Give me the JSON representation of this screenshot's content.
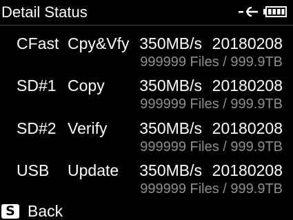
{
  "header": {
    "title": "Detail Status",
    "icons": [
      "connection-icon",
      "battery-icon"
    ]
  },
  "rows": [
    {
      "device": "CFast",
      "operation": "Cpy&Vfy",
      "speed": "350MB/s",
      "date": "20180208",
      "files": "999999 Files / 999.9TB"
    },
    {
      "device": "SD#1",
      "operation": "Copy",
      "speed": "350MB/s",
      "date": "20180208",
      "files": "999999 Files / 999.9TB"
    },
    {
      "device": "SD#2",
      "operation": "Verify",
      "speed": "350MB/s",
      "date": "20180208",
      "files": "999999 Files / 999.9TB"
    },
    {
      "device": "USB",
      "operation": "Update",
      "speed": "350MB/s",
      "date": "20180208",
      "files": "999999 Files / 999.9TB"
    }
  ],
  "footer": {
    "key_label": "S",
    "back_label": "Back"
  },
  "colors": {
    "background": "#000000",
    "primary_text": "#ffffff",
    "secondary_text": "#8e8e8e"
  }
}
